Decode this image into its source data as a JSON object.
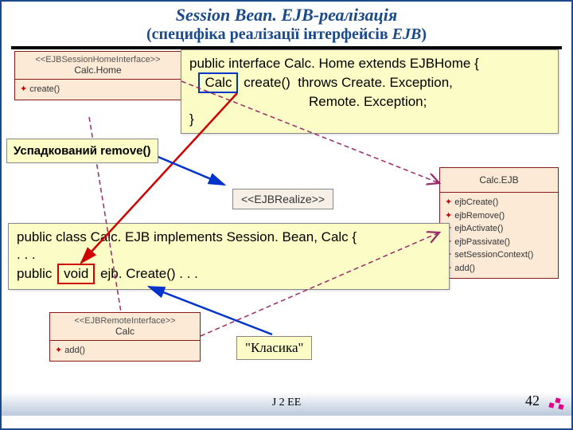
{
  "title": "Session Bean. EJB-реалізація",
  "subtitle_prefix": "(специфіка реалізації інтерфейсів ",
  "subtitle_ejb": "EJB",
  "subtitle_suffix": ")",
  "code1": {
    "line1a": "public interface Calc. Home extends EJBHome {",
    "boxed_calc": "Calc",
    "line1b_return_method": "create()",
    "line1b_throws": "throws Create. Exception,",
    "line1c": "Remote. Exception;",
    "close": "}"
  },
  "label_inherited": "Успадкований remove()",
  "stereo_realize": "<<EJBRealize>>",
  "code2": {
    "line1": "public class Calc. EJB implements Session. Bean, Calc {",
    "line2": ". . .",
    "line3a": "public",
    "boxed_void": "void",
    "line3b": "ejb. Create() . . ."
  },
  "label_classic": "\"Класика\"",
  "uml": {
    "calcHome": {
      "stereo": "<<EJBSessionHomeInterface>>",
      "name": "Calc.Home",
      "methods": [
        "create()"
      ]
    },
    "calcEJB": {
      "name": "Calc.EJB",
      "methods": [
        "ejbCreate()",
        "ejbRemove()",
        "ejbActivate()",
        "ejbPassivate()",
        "setSessionContext()",
        "add()"
      ]
    },
    "calc": {
      "stereo": "<<EJBRemoteInterface>>",
      "name": "Calc",
      "methods": [
        "add()"
      ]
    }
  },
  "footer": {
    "j2ee": "J 2 EE",
    "page": "42"
  }
}
